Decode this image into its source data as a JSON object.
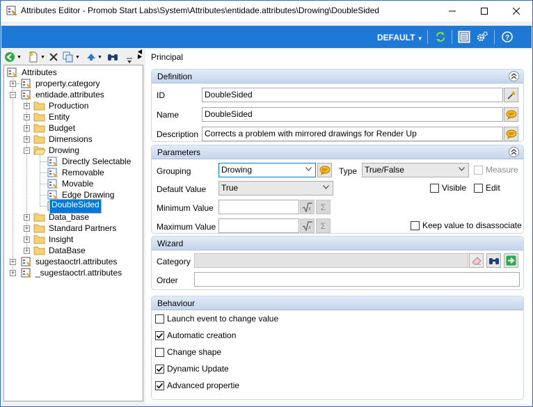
{
  "window": {
    "title": "Attributes Editor - Promob Start Labs\\System\\Attributes\\entidade.attributes\\Drowing\\DoubleSided"
  },
  "ribbon": {
    "profile_label": "DEFAULT"
  },
  "tree": {
    "root": "Attributes",
    "items": [
      {
        "label": "property.category"
      },
      {
        "label": "entidade.attributes"
      },
      {
        "label": "Production"
      },
      {
        "label": "Entity"
      },
      {
        "label": "Budget"
      },
      {
        "label": "Dimensions"
      },
      {
        "label": "Drowing"
      },
      {
        "label": "Directly Selectable"
      },
      {
        "label": "Removable"
      },
      {
        "label": "Movable"
      },
      {
        "label": "Edge Drawing"
      },
      {
        "label": "DoubleSided"
      },
      {
        "label": "Data_base"
      },
      {
        "label": "Standard Partners"
      },
      {
        "label": "Insight"
      },
      {
        "label": "DataBase"
      },
      {
        "label": "sugestaoctrl.attributes"
      },
      {
        "label": "_sugestaoctrl.attributes"
      }
    ]
  },
  "main": {
    "title": "Principal",
    "definition": {
      "header": "Definition",
      "id_label": "ID",
      "id_value": "DoubleSided",
      "name_label": "Name",
      "name_value": "DoubleSided",
      "description_label": "Description",
      "description_value": "Corrects a problem with mirrored drawings for Render Up"
    },
    "parameters": {
      "header": "Parameters",
      "grouping_label": "Grouping",
      "grouping_value": "Drowing",
      "type_label": "Type",
      "type_value": "True/False",
      "measure_label": "Measure",
      "default_label": "Default Value",
      "default_value": "True",
      "visible_label": "Visible",
      "edit_label": "Edit",
      "min_label": "Minimum Value",
      "max_label": "Maximum Value",
      "keep_label": "Keep value to disassociate",
      "sigma": "Σ"
    },
    "wizard": {
      "header": "Wizard",
      "category_label": "Category",
      "order_label": "Order"
    },
    "behaviour": {
      "header": "Behaviour",
      "items": [
        {
          "label": "Launch event to change value",
          "checked": false
        },
        {
          "label": "Automatic creation",
          "checked": true
        },
        {
          "label": "Change shape",
          "checked": false
        },
        {
          "label": "Dynamic Update",
          "checked": true
        },
        {
          "label": "Advanced propertie",
          "checked": true
        }
      ]
    }
  },
  "colors": {
    "ribbon": "#1e78d6",
    "selection": "#0078d7",
    "panel_header": "#c4d5ec"
  }
}
